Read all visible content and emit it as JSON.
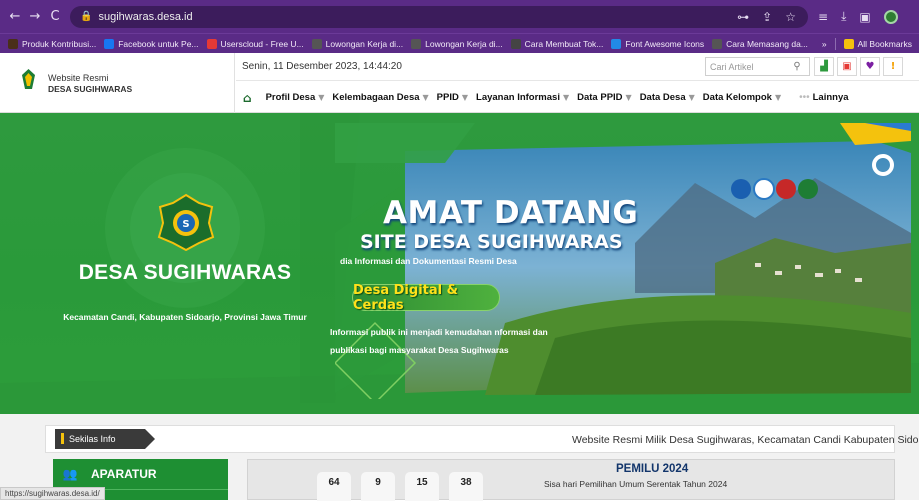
{
  "browser": {
    "url": "sugihwaras.desa.id",
    "status_url": "https://sugihwaras.desa.id/"
  },
  "bookmarks": [
    {
      "label": "Produk Kontribusi...",
      "color": "#4a2f1a"
    },
    {
      "label": "Facebook untuk Pe...",
      "color": "#1877f2"
    },
    {
      "label": "Userscloud - Free U...",
      "color": "#e53935"
    },
    {
      "label": "Lowongan Kerja di...",
      "color": "#555555"
    },
    {
      "label": "Lowongan Kerja di...",
      "color": "#555555"
    },
    {
      "label": "Cara Membuat Tok...",
      "color": "#444444"
    },
    {
      "label": "Font Awesome Icons",
      "color": "#228ae6"
    },
    {
      "label": "Cara Memasang da...",
      "color": "#555555"
    }
  ],
  "bookmarks_more": "»",
  "bookmarks_all": "All Bookmarks",
  "site": {
    "brand_line1": "Website Resmi",
    "brand_line2": "DESA SUGIHWARAS",
    "date": "Senin, 11 Desember 2023, 14:44:20",
    "search_placeholder": "Cari Artikel"
  },
  "nav": [
    {
      "label": "Profil Desa",
      "caret": true
    },
    {
      "label": "Kelembagaan Desa",
      "caret": true
    },
    {
      "label": "PPID",
      "caret": true
    },
    {
      "label": "Layanan Informasi",
      "caret": true
    },
    {
      "label": "Data PPID",
      "caret": true
    },
    {
      "label": "Data Desa",
      "caret": true
    },
    {
      "label": "Data Kelompok",
      "caret": true
    }
  ],
  "nav_more": "Lainnya",
  "hero": {
    "title": "DESA SUGIHWARAS",
    "subtitle": "Kecamatan Candi, Kabupaten Sidoarjo, Provinsi Jawa Timur",
    "welcome_line1": "AMAT DATANG",
    "welcome_line2": "SITE DESA SUGIHWARAS",
    "welcome_line3": "dia Informasi dan Dokumentasi Resmi Desa",
    "pill": "Desa Digital & Cerdas",
    "paragraph": "Informasi publik ini menjadi kemudahan nformasi dan publikasi bagi masyarakat Desa Sugihwaras"
  },
  "ticker": {
    "label": "Sekilas Info",
    "text": "Website Resmi Milik Desa Sugihwaras, Kecamatan Candi Kabupaten Sidoarjo"
  },
  "sidebar": {
    "aparatur": "APARATUR"
  },
  "countdown": {
    "values": [
      "64",
      "9",
      "15",
      "38"
    ],
    "title": "PEMILU 2024",
    "subtitle": "Sisa hari Pemilihan Umum Serentak Tahun 2024"
  },
  "colors": {
    "hero_green": "#2e9a3e",
    "nav_icon_green": "#1c6a2d",
    "chrome_purple": "#5a2b86",
    "pemilu_blue": "#12356b"
  }
}
